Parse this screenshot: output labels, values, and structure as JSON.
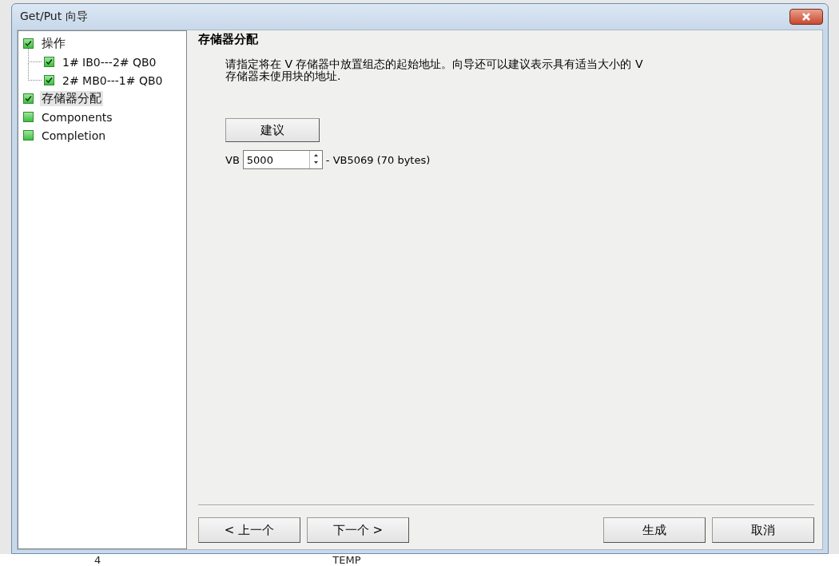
{
  "window": {
    "title": "Get/Put 向导"
  },
  "tree": [
    {
      "label": "操作",
      "checked": true,
      "selected": false,
      "children": [
        {
          "label": "1# IB0---2# QB0",
          "checked": true,
          "selected": false
        },
        {
          "label": "2# MB0---1# QB0",
          "checked": true,
          "selected": false
        }
      ]
    },
    {
      "label": "存储器分配",
      "checked": true,
      "selected": true
    },
    {
      "label": "Components",
      "checked": false,
      "selected": false
    },
    {
      "label": "Completion",
      "checked": false,
      "selected": false
    }
  ],
  "page": {
    "heading": "存储器分配",
    "description": "请指定将在 V 存储器中放置组态的起始地址。向导还可以建议表示具有适当大小的 V 存储器未使用块的地址.",
    "suggest_button": "建议",
    "address_prefix": "VB",
    "address_value": "5000",
    "address_range": "- VB5069 (70 bytes)"
  },
  "buttons": [
    {
      "label": "< 上一个"
    },
    {
      "label": "下一个 >"
    },
    {
      "label": "生成"
    },
    {
      "label": "取消"
    }
  ],
  "background_row": [
    "4",
    "TEMP"
  ]
}
